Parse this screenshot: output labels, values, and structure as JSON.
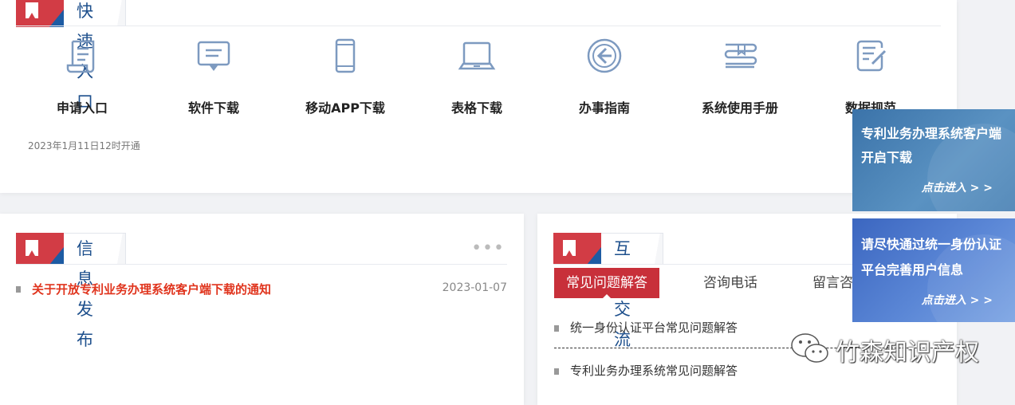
{
  "quick_entry": {
    "title": "快速入口",
    "items": [
      {
        "label": "申请入口",
        "icon": "document-scroll-icon"
      },
      {
        "label": "软件下载",
        "icon": "download-screen-icon"
      },
      {
        "label": "移动APP下载",
        "icon": "mobile-phone-icon"
      },
      {
        "label": "表格下载",
        "icon": "laptop-icon"
      },
      {
        "label": "办事指南",
        "icon": "arrow-left-circle-icon"
      },
      {
        "label": "系统使用手册",
        "icon": "manual-book-icon"
      },
      {
        "label": "数据规范",
        "icon": "edit-document-icon"
      }
    ],
    "note": "2023年1月11日12时开通"
  },
  "info_release": {
    "title": "信息发布",
    "more": "•••",
    "news": [
      {
        "title": "关于开放专利业务办理系统客户端下载的通知",
        "date": "2023-01-07"
      }
    ]
  },
  "interaction": {
    "title": "互动交流",
    "tabs": [
      {
        "label": "常见问题解答",
        "active": true
      },
      {
        "label": "咨询电话",
        "active": false
      },
      {
        "label": "留言咨",
        "active": false
      }
    ],
    "faqs": [
      {
        "title": "统一身份认证平台常见问题解答"
      },
      {
        "title": "专利业务办理系统常见问题解答"
      }
    ]
  },
  "banners": [
    {
      "line1": "专利业务办理系统客户端",
      "line2": "开启下载",
      "action": "点击进入 > >"
    },
    {
      "line1": "请尽快通过统一身份认证",
      "line2": "平台完善用户信息",
      "action": "点击进入 > >"
    }
  ],
  "watermark": {
    "text": "竹森知识产权"
  },
  "colors": {
    "accent_red": "#c8303a",
    "accent_blue": "#1d5ba3",
    "icon_blue": "#7d9ac0",
    "news_red": "#e0341d"
  }
}
